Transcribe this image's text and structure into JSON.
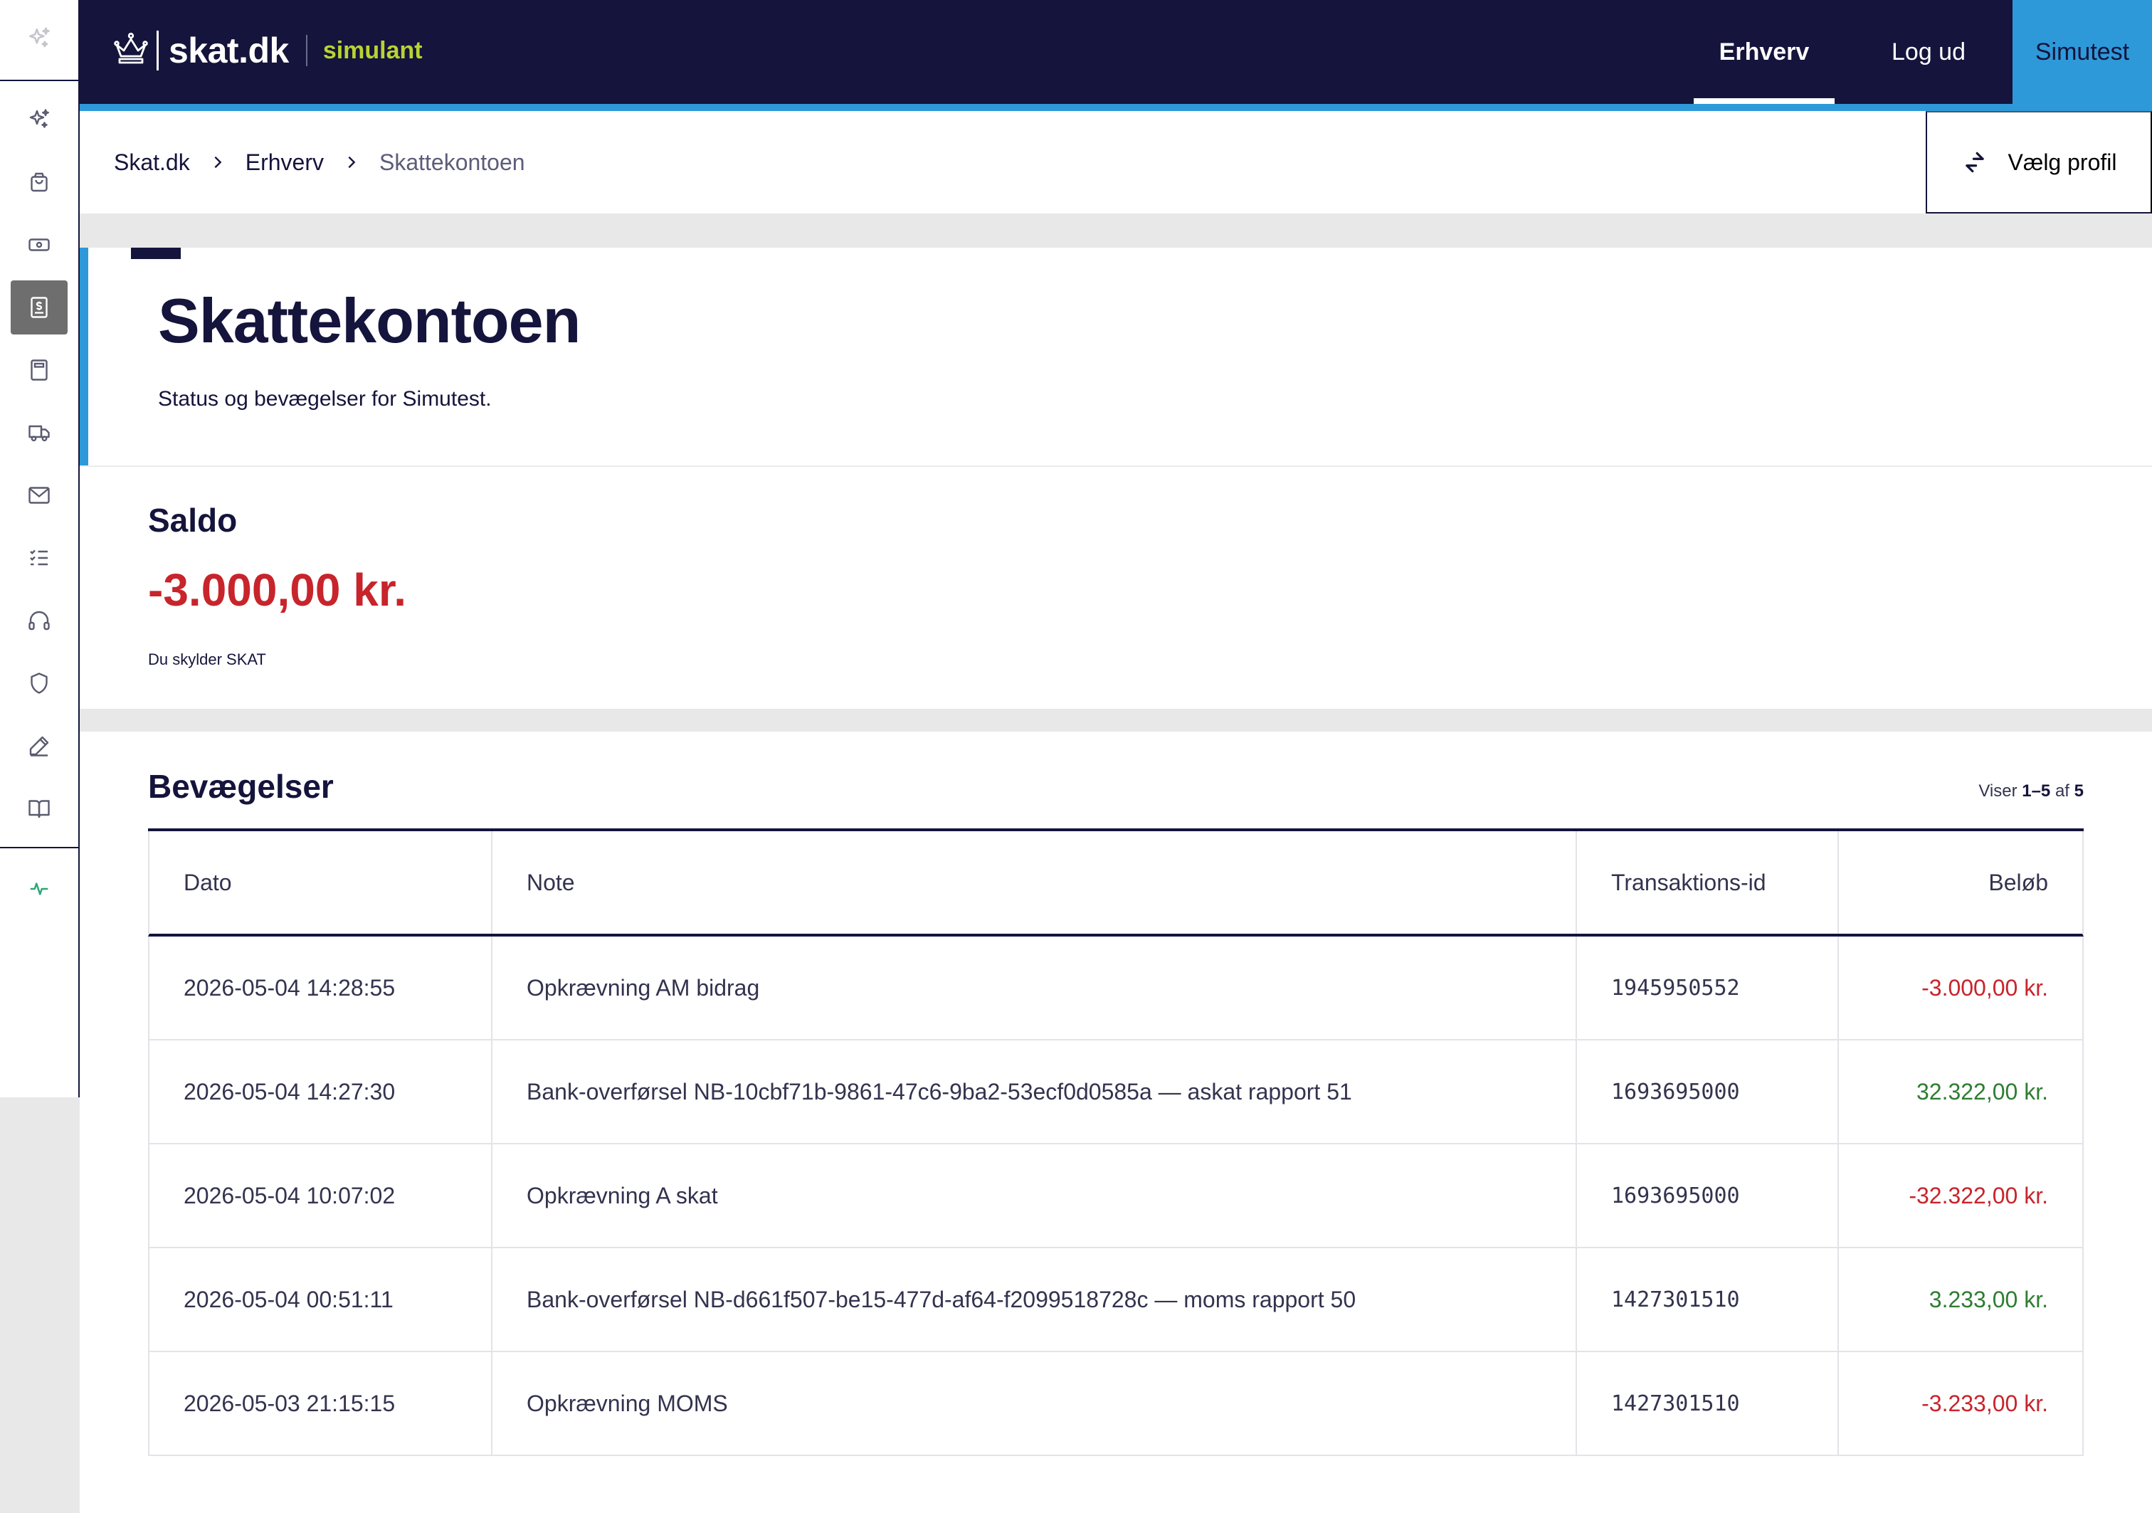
{
  "header": {
    "brand_name": "skat.dk",
    "brand_tag": "simulant",
    "nav": {
      "erhverv": "Erhverv",
      "logout": "Log ud",
      "user": "Simutest"
    }
  },
  "breadcrumb": {
    "items": [
      "Skat.dk",
      "Erhverv",
      "Skattekontoen"
    ],
    "profile_button": "Vælg profil"
  },
  "hero": {
    "title": "Skattekontoen",
    "subtitle": "Status og bevægelser for Simutest."
  },
  "saldo": {
    "label": "Saldo",
    "amount": "-3.000,00 kr.",
    "note": "Du skylder SKAT"
  },
  "movements": {
    "title": "Bevægelser",
    "count_prefix": "Viser",
    "count_range": "1–5",
    "count_of": "af",
    "count_total": "5",
    "columns": [
      "Dato",
      "Note",
      "Transaktions-id",
      "Beløb"
    ],
    "rows": [
      {
        "date": "2026-05-04 14:28:55",
        "note": "Opkrævning AM bidrag",
        "id": "1945950552",
        "amount": "-3.000,00 kr.",
        "sign": "neg"
      },
      {
        "date": "2026-05-04 14:27:30",
        "note": "Bank-overførsel NB-10cbf71b-9861-47c6-9ba2-53ecf0d0585a — askat rapport 51",
        "id": "1693695000",
        "amount": "32.322,00 kr.",
        "sign": "pos"
      },
      {
        "date": "2026-05-04 10:07:02",
        "note": "Opkrævning A skat",
        "id": "1693695000",
        "amount": "-32.322,00 kr.",
        "sign": "neg"
      },
      {
        "date": "2026-05-04 00:51:11",
        "note": "Bank-overførsel NB-d661f507-be15-477d-af64-f2099518728c — moms rapport 50",
        "id": "1427301510",
        "amount": "3.233,00 kr.",
        "sign": "pos"
      },
      {
        "date": "2026-05-03 21:15:15",
        "note": "Opkrævning MOMS",
        "id": "1427301510",
        "amount": "-3.233,00 kr.",
        "sign": "neg"
      }
    ]
  },
  "colors": {
    "navy": "#14143c",
    "accent_blue": "#2e99d9",
    "brand_green": "#b9d332",
    "negative": "#c8242b",
    "positive": "#2e7d32"
  },
  "rail": {
    "icons": [
      "sparkle-icon",
      "sparkle-icon",
      "shopping-bag-icon",
      "banknote-icon",
      "receipt-icon",
      "calculator-icon",
      "truck-icon",
      "mail-icon",
      "checklist-icon",
      "headset-icon",
      "shield-icon",
      "pen-icon",
      "book-icon",
      "activity-icon"
    ]
  }
}
